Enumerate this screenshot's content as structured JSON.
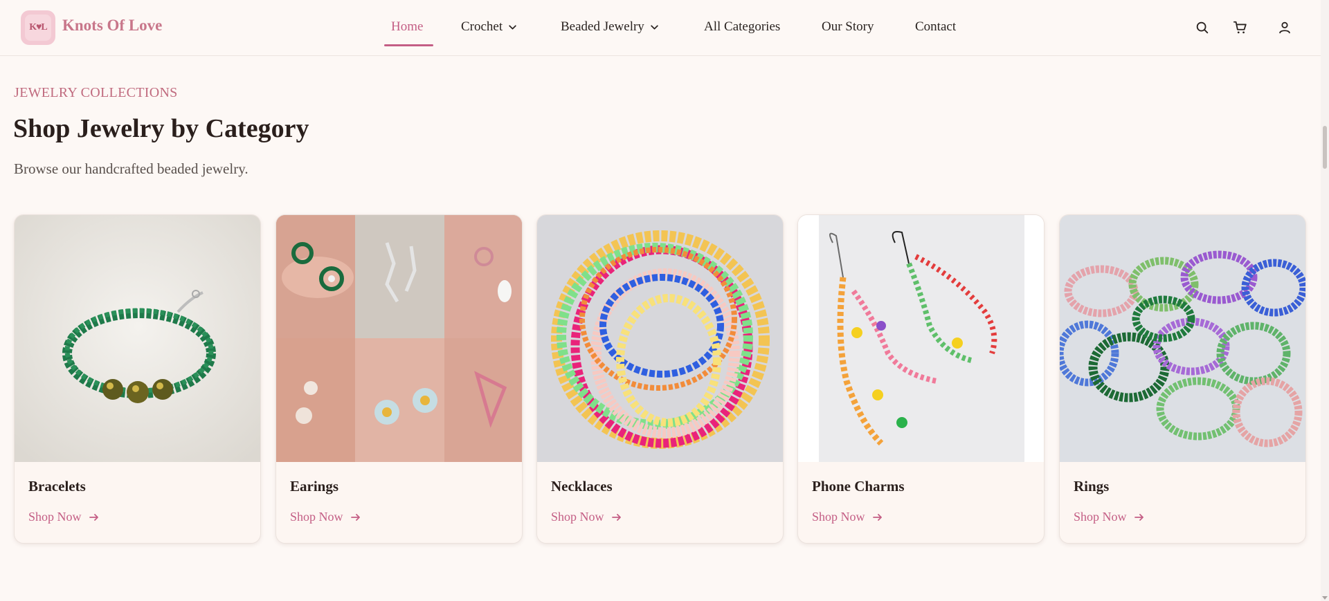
{
  "brand": {
    "logo_text": "K♥L",
    "name": "Knots Of Love"
  },
  "nav": {
    "items": [
      {
        "label": "Home",
        "active": true
      },
      {
        "label": "Crochet",
        "has_dropdown": true
      },
      {
        "label": "Beaded Jewelry",
        "has_dropdown": true
      },
      {
        "label": "All Categories"
      },
      {
        "label": "Our Story"
      },
      {
        "label": "Contact"
      }
    ]
  },
  "header_icons": [
    "search-icon",
    "cart-icon",
    "user-icon"
  ],
  "section": {
    "eyebrow": "JEWELRY COLLECTIONS",
    "title": "Shop Jewelry by Category",
    "subtitle": "Browse our handcrafted beaded jewelry."
  },
  "categories": [
    {
      "name": "Bracelets",
      "link_label": "Shop Now"
    },
    {
      "name": "Earings",
      "link_label": "Shop Now"
    },
    {
      "name": "Necklaces",
      "link_label": "Shop Now"
    },
    {
      "name": "Phone Charms",
      "link_label": "Shop Now"
    },
    {
      "name": "Rings",
      "link_label": "Shop Now"
    }
  ],
  "colors": {
    "accent": "#c45e85",
    "brand": "#c8768a",
    "background": "#fdf8f5"
  }
}
